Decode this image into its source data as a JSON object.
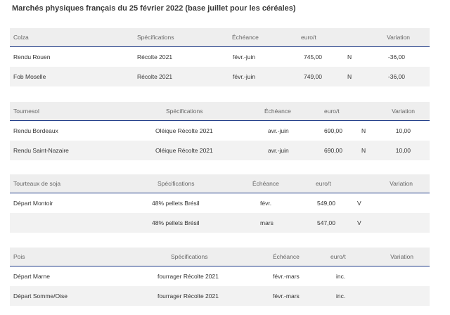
{
  "page_title": "Marchés physiques français du 25 février 2022 (base juillet pour les céréales)",
  "headers": {
    "specifications": "Spécifications",
    "echeance": "Échéance",
    "price": "euro/t",
    "variation": "Variation"
  },
  "sections": [
    {
      "name": "Colza",
      "rows": [
        {
          "place": "Rendu Rouen",
          "spec": "Récolte 2021",
          "echeance": "févr.-juin",
          "price": "745,00",
          "flag": "N",
          "variation": "-36,00"
        },
        {
          "place": "Fob Moselle",
          "spec": "Récolte 2021",
          "echeance": "févr.-juin",
          "price": "749,00",
          "flag": "N",
          "variation": "-36,00"
        }
      ]
    },
    {
      "name": "Tournesol",
      "rows": [
        {
          "place": "Rendu Bordeaux",
          "spec": "Oléique Récolte 2021",
          "echeance": "avr.-juin",
          "price": "690,00",
          "flag": "N",
          "variation": "10,00"
        },
        {
          "place": "Rendu Saint-Nazaire",
          "spec": "Oléique Récolte 2021",
          "echeance": "avr.-juin",
          "price": "690,00",
          "flag": "N",
          "variation": "10,00"
        }
      ]
    },
    {
      "name": "Tourteaux de soja",
      "rows": [
        {
          "place": "Départ Montoir",
          "spec": "48% pellets Brésil",
          "echeance": "févr.",
          "price": "549,00",
          "flag": "V",
          "variation": ""
        },
        {
          "place": "",
          "spec": "48% pellets Brésil",
          "echeance": "mars",
          "price": "547,00",
          "flag": "V",
          "variation": ""
        }
      ]
    },
    {
      "name": "Pois",
      "rows": [
        {
          "place": "Départ Marne",
          "spec": "fourrager Récolte 2021",
          "echeance": "févr.-mars",
          "price": "inc.",
          "flag": "",
          "variation": ""
        },
        {
          "place": "Départ Somme/Oise",
          "spec": "fourrager Récolte 2021",
          "echeance": "févr.-mars",
          "price": "inc.",
          "flag": "",
          "variation": ""
        }
      ]
    }
  ]
}
